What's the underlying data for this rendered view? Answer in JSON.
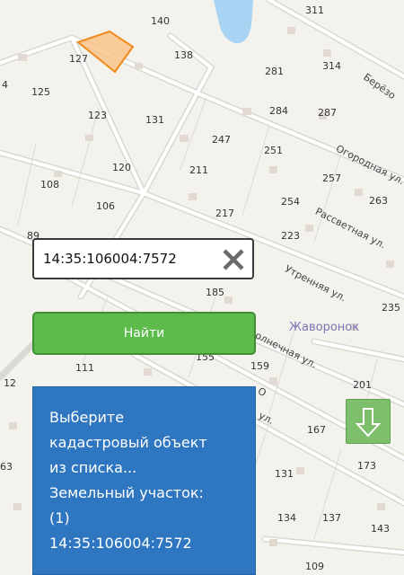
{
  "search": {
    "value": "14:35:106004:7572"
  },
  "find_button": {
    "label": "Найти"
  },
  "info_panel": {
    "lines": [
      "Выберите",
      "кадастровый объект",
      "из списка...",
      "Земельный участок:",
      "(1)",
      "14:35:106004:7572"
    ]
  },
  "map": {
    "place": "Жаворонок",
    "streets": [
      "Берёзо",
      "Огородная ул.",
      "Рассветная ул.",
      "Утренняя ул.",
      "олнечная ул.",
      "О",
      "ул."
    ],
    "parcel_numbers": [
      "311",
      "140",
      "127",
      "138",
      "281",
      "314",
      "4",
      "125",
      "123",
      "131",
      "284",
      "287",
      "247",
      "251",
      "120",
      "211",
      "257",
      "108",
      "106",
      "254",
      "263",
      "217",
      "89",
      "223",
      "185",
      "235",
      "155",
      "159",
      "111",
      "12",
      "201",
      "167",
      "173",
      "63",
      "131",
      "134",
      "137",
      "143",
      "109"
    ]
  },
  "colors": {
    "find_button": "#5cbb4a",
    "info_panel": "#2f76c0",
    "down_button": "#7ebf6c",
    "highlight": "#f9c48a"
  },
  "icons": {
    "clear": "close-icon",
    "down": "arrow-down-icon"
  }
}
